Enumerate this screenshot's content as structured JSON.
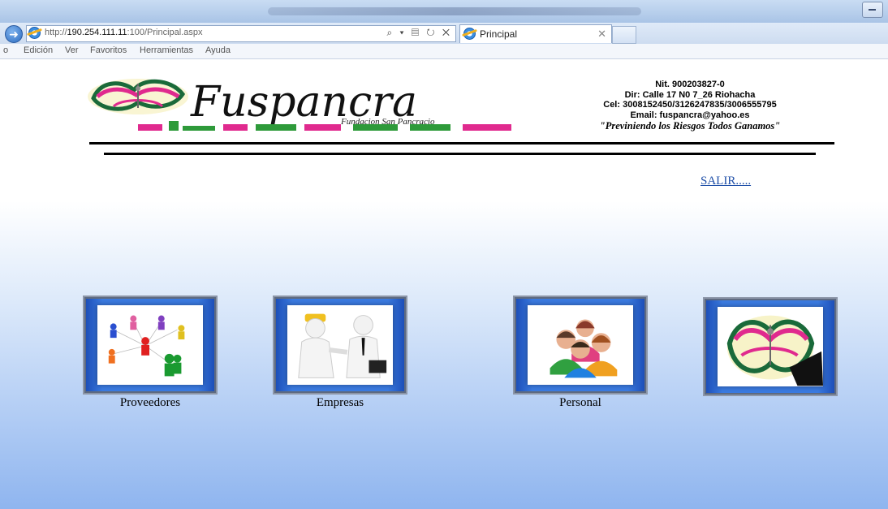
{
  "browser": {
    "address_url_prefix": "http://",
    "address_url_host": "190.254.111.11",
    "address_url_rest": ":100/Principal.aspx",
    "address_tools": "⌕ ▾ ▤ ↻ ✕",
    "tab_title": "Principal",
    "tab_close": "✕",
    "menu": [
      "o",
      "Edición",
      "Ver",
      "Favoritos",
      "Herramientas",
      "Ayuda"
    ]
  },
  "header": {
    "logo_text": "Fuspancra",
    "logo_subtext": "Fundacion San Pancracio",
    "nit": "Nit. 900203827-0",
    "direccion": "Dir: Calle 17 N0 7_26 Riohacha",
    "celular": "Cel: 3008152450/3126247835/3006555795",
    "email": "Email: fuspancra@yahoo.es",
    "slogan": "\"Previniendo los Riesgos Todos Ganamos\""
  },
  "salir_label": "SALIR.....",
  "tiles": [
    {
      "label": "Proveedores",
      "icon": "network-people-icon"
    },
    {
      "label": "Empresas",
      "icon": "handshake-icon"
    },
    {
      "label": "Personal",
      "icon": "people-group-icon"
    },
    {
      "label": "",
      "icon": "fuspancra-emblem-icon"
    }
  ],
  "colors": {
    "link": "#1f4fa8",
    "tile_blue": "#3a7ae0",
    "page_gradient_bottom": "#8fb5ef"
  }
}
